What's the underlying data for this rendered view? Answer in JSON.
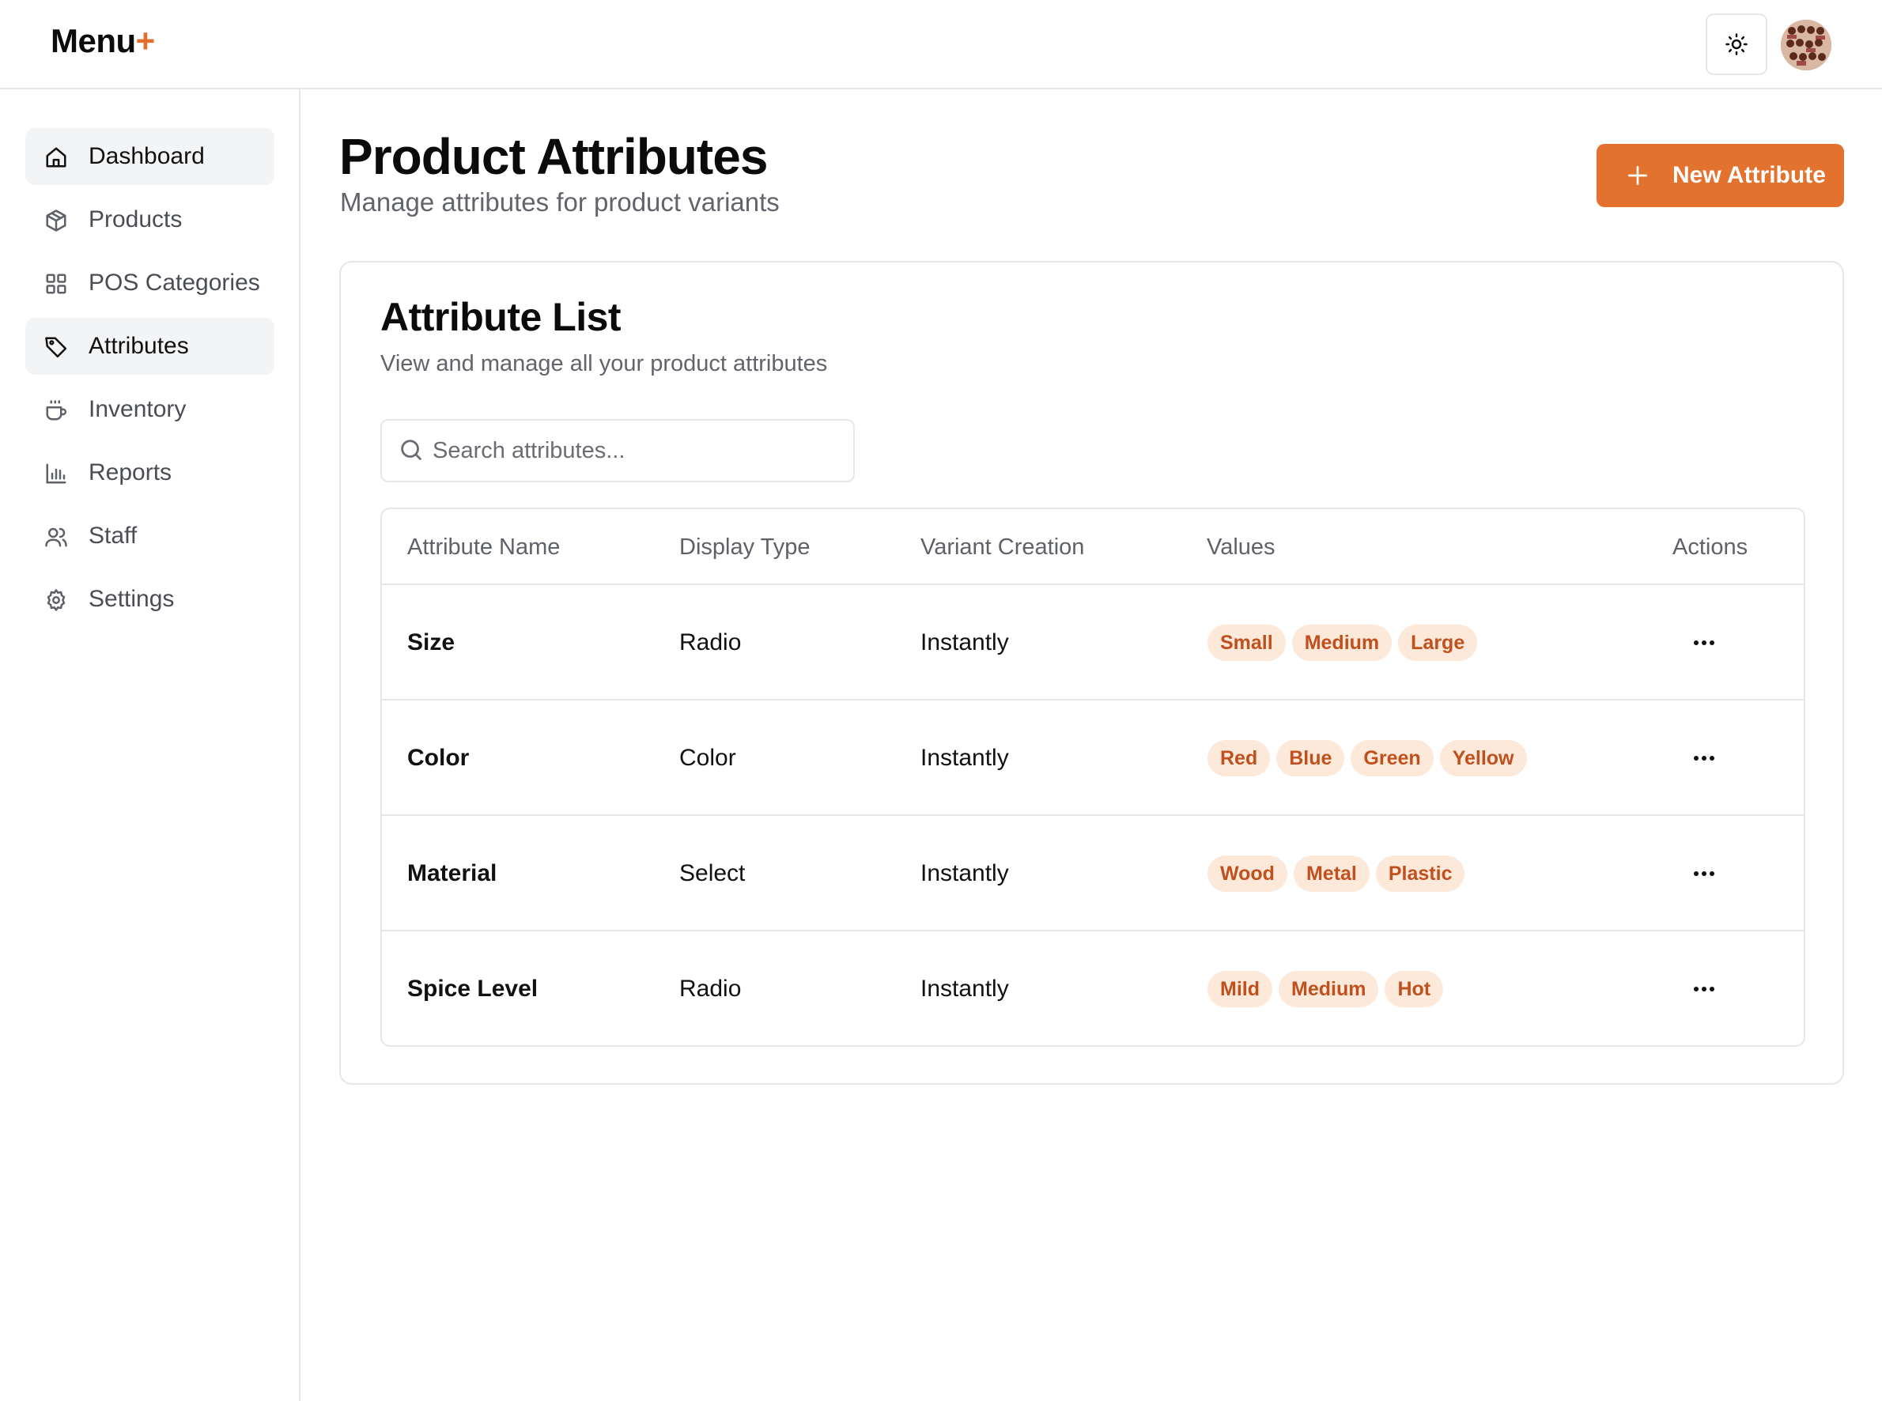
{
  "app": {
    "logo_text": "Menu",
    "logo_plus": "+",
    "accent": "#e4722f"
  },
  "header": {
    "theme_icon": "sun-icon",
    "avatar": "user-avatar"
  },
  "sidebar": {
    "items": [
      {
        "label": "Dashboard",
        "icon": "home-icon",
        "active": true
      },
      {
        "label": "Products",
        "icon": "box-icon",
        "active": false
      },
      {
        "label": "POS Categories",
        "icon": "grid-icon",
        "active": false
      },
      {
        "label": "Attributes",
        "icon": "tag-icon",
        "active": true
      },
      {
        "label": "Inventory",
        "icon": "cup-icon",
        "active": false
      },
      {
        "label": "Reports",
        "icon": "bar-chart-icon",
        "active": false
      },
      {
        "label": "Staff",
        "icon": "users-icon",
        "active": false
      },
      {
        "label": "Settings",
        "icon": "gear-icon",
        "active": false
      }
    ]
  },
  "page": {
    "title": "Product Attributes",
    "subtitle": "Manage attributes for product variants",
    "new_button_label": "New Attribute"
  },
  "card": {
    "title": "Attribute List",
    "subtitle": "View and manage all your product attributes",
    "search_placeholder": "Search attributes..."
  },
  "table": {
    "columns": [
      "Attribute Name",
      "Display Type",
      "Variant Creation",
      "Values",
      "Actions"
    ],
    "rows": [
      {
        "name": "Size",
        "display_type": "Radio",
        "variant_creation": "Instantly",
        "values": [
          "Small",
          "Medium",
          "Large"
        ]
      },
      {
        "name": "Color",
        "display_type": "Color",
        "variant_creation": "Instantly",
        "values": [
          "Red",
          "Blue",
          "Green",
          "Yellow"
        ]
      },
      {
        "name": "Material",
        "display_type": "Select",
        "variant_creation": "Instantly",
        "values": [
          "Wood",
          "Metal",
          "Plastic"
        ]
      },
      {
        "name": "Spice Level",
        "display_type": "Radio",
        "variant_creation": "Instantly",
        "values": [
          "Mild",
          "Medium",
          "Hot"
        ]
      }
    ]
  }
}
